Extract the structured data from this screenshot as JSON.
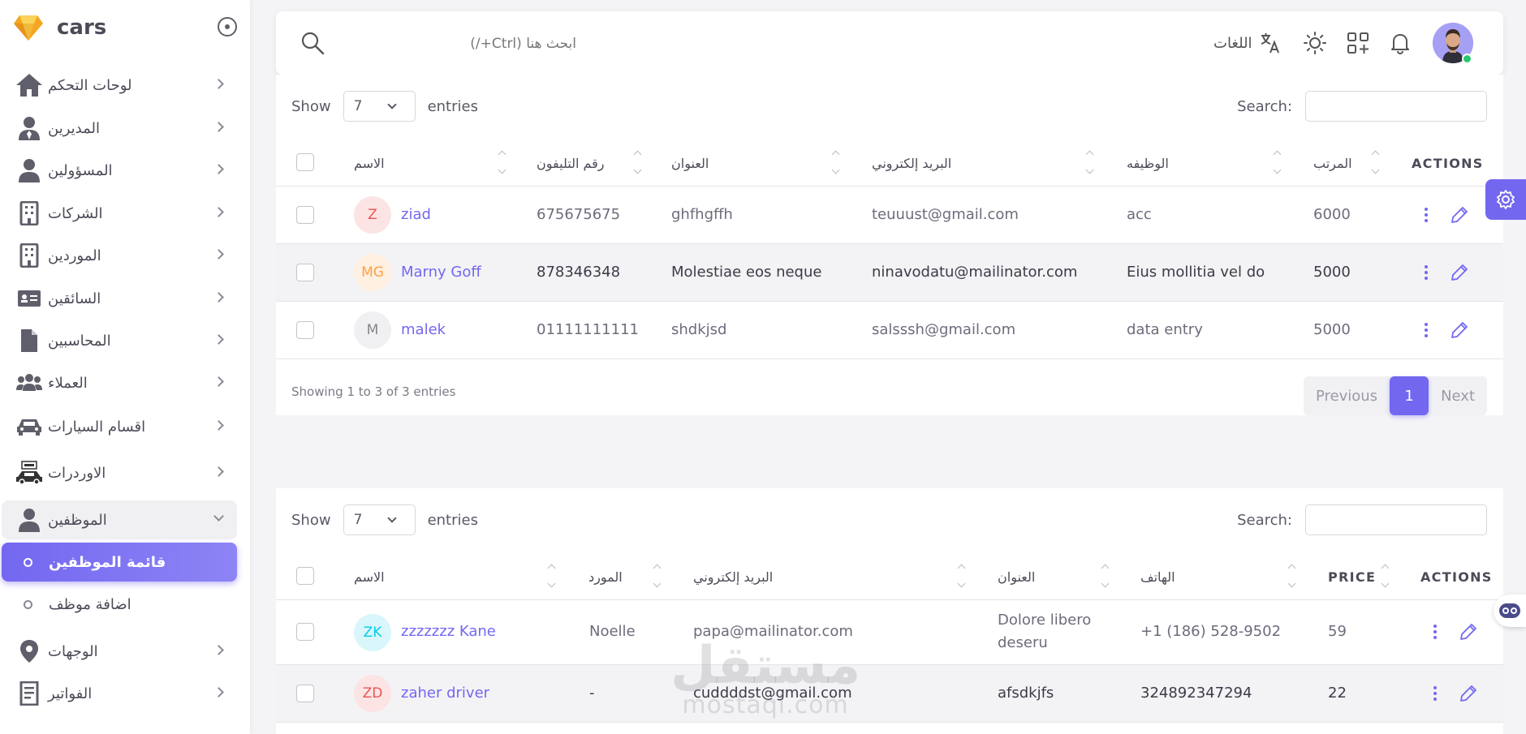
{
  "app": {
    "name": "cars"
  },
  "sidebar": {
    "items": [
      {
        "label": "لوحات التحكم",
        "icon": "home-icon"
      },
      {
        "label": "المديرين",
        "icon": "user-tie-icon"
      },
      {
        "label": "المسؤولين",
        "icon": "user-icon"
      },
      {
        "label": "الشركات",
        "icon": "building-icon"
      },
      {
        "label": "الموردين",
        "icon": "building-icon"
      },
      {
        "label": "السائقين",
        "icon": "id-card-icon"
      },
      {
        "label": "المحاسبين",
        "icon": "file-icon"
      },
      {
        "label": "العملاء",
        "icon": "users-icon"
      },
      {
        "label": "اقسام السيارات",
        "icon": "car-icon"
      },
      {
        "label": "الاوردرات",
        "icon": "rent-car-icon"
      },
      {
        "label": "الموظفين",
        "icon": "user-icon",
        "open": true
      },
      {
        "label": "الوجهات",
        "icon": "map-pin-icon"
      },
      {
        "label": "الفواتير",
        "icon": "invoice-icon"
      }
    ],
    "sub_items": [
      {
        "label": "قائمة الموظفين",
        "active": true
      },
      {
        "label": "اضافة موظف",
        "active": false
      }
    ]
  },
  "navbar": {
    "search_placeholder": "ابحث هنا (Ctrl+/)",
    "languages_label": "اللغات"
  },
  "employees_table": {
    "show_label": "Show",
    "page_size": "7",
    "entries_label": "entries",
    "search_label": "Search:",
    "columns": [
      "الاسم",
      "رقم التليفون",
      "العنوان",
      "البريد إلكتروني",
      "الوظيفه",
      "المرتب",
      "ACTIONS"
    ],
    "rows": [
      {
        "initials": "Z",
        "avatar_bg": "#fce4e4",
        "avatar_fg": "#ea5455",
        "name": "ziad",
        "phone": "675675675",
        "address": "ghfhgffh",
        "email": "teuuust@gmail.com",
        "job": "acc",
        "salary": "6000"
      },
      {
        "initials": "MG",
        "avatar_bg": "#fff0e1",
        "avatar_fg": "#ff9f43",
        "name": "Marny Goff",
        "phone": "878346348",
        "address": "Molestiae eos neque",
        "email": "ninavodatu@mailinator.com",
        "job": "Eius mollitia vel do",
        "salary": "5000"
      },
      {
        "initials": "M",
        "avatar_bg": "#f0f0f2",
        "avatar_fg": "#82868b",
        "name": "malek",
        "phone": "01111111111",
        "address": "shdkjsd",
        "email": "salsssh@gmail.com",
        "job": "data entry",
        "salary": "5000"
      }
    ],
    "info": "Showing 1 to 3 of 3 entries",
    "pagination": {
      "previous": "Previous",
      "current": "1",
      "next": "Next"
    }
  },
  "drivers_table": {
    "show_label": "Show",
    "page_size": "7",
    "entries_label": "entries",
    "search_label": "Search:",
    "columns": [
      "الاسم",
      "المورد",
      "البريد إلكتروني",
      "العنوان",
      "الهاتف",
      "PRICE",
      "ACTIONS"
    ],
    "rows": [
      {
        "initials": "ZK",
        "avatar_bg": "#d9f6fb",
        "avatar_fg": "#00cfe8",
        "name": "zzzzzzz Kane",
        "supplier": "Noelle",
        "email": "papa@mailinator.com",
        "address_line1": "Dolore libero",
        "address_line2": "deseru",
        "phone": "+1 (186) 528-9502",
        "price": "59"
      },
      {
        "initials": "ZD",
        "avatar_bg": "#fce4e4",
        "avatar_fg": "#ea5455",
        "name": "zaher driver",
        "supplier": "-",
        "email": "cuddddst@gmail.com",
        "address_line1": "afsdkjfs",
        "address_line2": "",
        "phone": "324892347294",
        "price": "22"
      }
    ]
  },
  "watermark": {
    "line1": "مستقل",
    "line2": "mostaqi.com"
  },
  "colors": {
    "accent": "#7367f0",
    "text": "#4b4b58",
    "muted": "#6e6b7b",
    "stripe": "#f3f3f5"
  }
}
